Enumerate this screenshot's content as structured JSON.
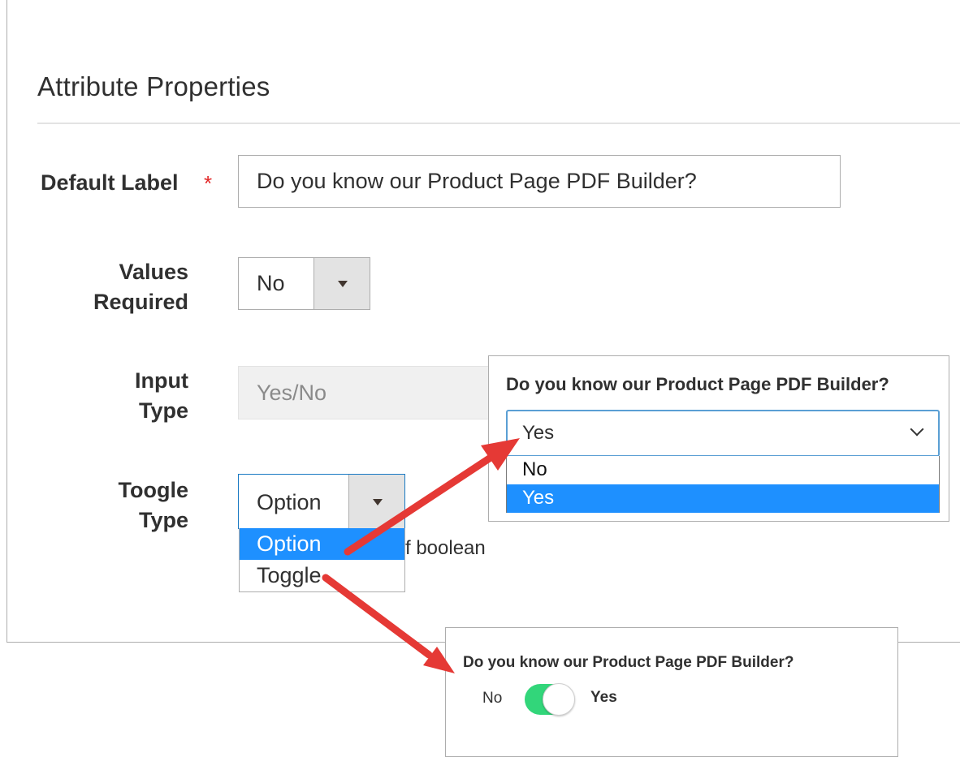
{
  "section": {
    "title": "Attribute Properties"
  },
  "default_label": {
    "label": "Default Label",
    "required_mark": "*",
    "value": "Do you know our Product Page PDF Builder?"
  },
  "values_required": {
    "label_line1": "Values",
    "label_line2": "Required",
    "selected": "No"
  },
  "input_type": {
    "label_line1": "Input",
    "label_line2": "Type",
    "value": "Yes/No"
  },
  "toogle_type": {
    "label_line1": "Toogle",
    "label_line2": "Type",
    "selected": "Option",
    "options": [
      "Option",
      "Toggle"
    ],
    "note_visible": "f boolean"
  },
  "option_preview": {
    "question": "Do you know our Product Page PDF Builder?",
    "selected": "Yes",
    "options": [
      "No",
      "Yes"
    ]
  },
  "toggle_preview": {
    "question": "Do you know our Product Page PDF Builder?",
    "off_label": "No",
    "on_label": "Yes",
    "state": "on"
  },
  "colors": {
    "accent_blue": "#1e90ff",
    "toggle_on": "#32d67a",
    "arrow_red": "#e53935",
    "required_red": "#e22626"
  }
}
